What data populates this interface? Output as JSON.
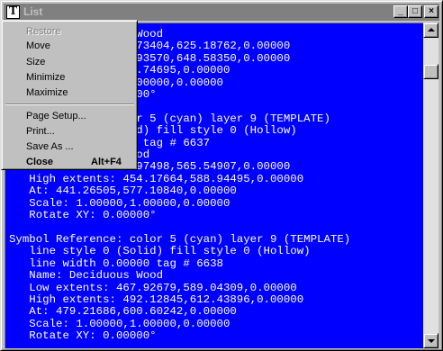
{
  "window": {
    "title": "List"
  },
  "titlebar_buttons": {
    "minimize": "_",
    "maximize": "□",
    "close": "×"
  },
  "system_icon": {
    "glyph": "T"
  },
  "menu": {
    "items": [
      {
        "label": "Restore",
        "shortcut": "",
        "disabled": true
      },
      {
        "label": "Move",
        "shortcut": ""
      },
      {
        "label": "Size",
        "shortcut": ""
      },
      {
        "label": "Minimize",
        "shortcut": ""
      },
      {
        "label": "Maximize",
        "shortcut": ""
      },
      {
        "label": "Page Setup...",
        "shortcut": ""
      },
      {
        "label": "Print...",
        "shortcut": ""
      },
      {
        "label": "Save As ...",
        "shortcut": ""
      },
      {
        "label": "Close",
        "shortcut": "Alt+F4"
      }
    ]
  },
  "log_lines": [
    "                 s Wood",
    "                69.73404,625.18762,0.00000",
    "               493.93570,648.58350,0.00000",
    "                636.74695,0.00000",
    "                ,1.00000,0.00000",
    "                00000°",
    "",
    "               color 5 (cyan) layer 9 (TEMPLATE)",
    "               Solid) fill style 0 (Hollow)",
    "               0000 tag # 6637",
    "               s Wood",
    "                29.97498,565.54907,0.00000",
    "   High extents: 454.17664,588.94495,0.00000",
    "   At: 441.26505,577.10840,0.00000",
    "   Scale: 1.00000,1.00000,0.00000",
    "   Rotate XY: 0.00000°",
    "",
    "Symbol Reference: color 5 (cyan) layer 9 (TEMPLATE)",
    "   line style 0 (Solid) fill style 0 (Hollow)",
    "   line width 0.00000 tag # 6638",
    "   Name: Deciduous Wood",
    "   Low extents: 467.92679,589.04309,0.00000",
    "   High extents: 492.12845,612.43896,0.00000",
    "   At: 479.21686,600.60242,0.00000",
    "   Scale: 1.00000,1.00000,0.00000",
    "   Rotate XY: 0.00000°"
  ]
}
